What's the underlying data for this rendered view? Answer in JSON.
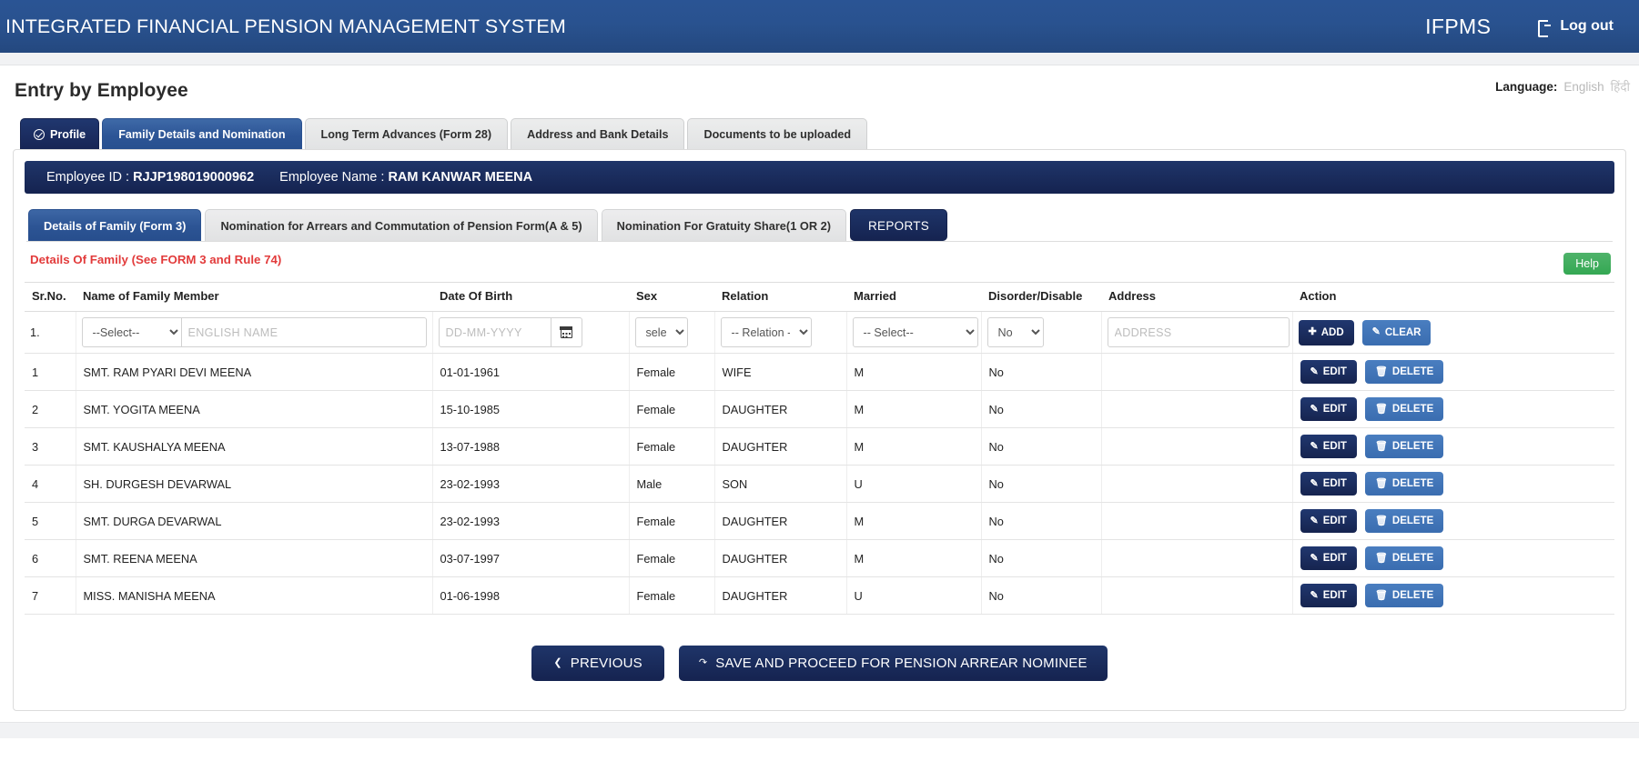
{
  "topbar": {
    "system_title": "INTEGRATED FINANCIAL PENSION MANAGEMENT SYSTEM",
    "brand": "IFPMS",
    "logout_label": "Log out",
    "logout_icon": "logout-icon"
  },
  "page": {
    "title": "Entry by Employee",
    "language_label": "Language:",
    "language_english": "English",
    "language_hindi": "हिंदी"
  },
  "main_tabs": [
    {
      "label": "Profile",
      "state": "completed",
      "icon": "check-circle-icon"
    },
    {
      "label": "Family Details and Nomination",
      "state": "active"
    },
    {
      "label": "Long Term Advances (Form 28)",
      "state": "normal"
    },
    {
      "label": "Address and Bank Details",
      "state": "normal"
    },
    {
      "label": "Documents to be uploaded",
      "state": "normal"
    }
  ],
  "employee": {
    "id_label": "Employee ID :",
    "id_value": "RJJP198019000962",
    "name_label": "Employee Name :",
    "name_value": "RAM KANWAR MEENA"
  },
  "sub_tabs": [
    {
      "label": "Details of Family (Form 3)",
      "state": "active"
    },
    {
      "label": "Nomination for Arrears and Commutation of Pension Form(A & 5)",
      "state": "normal"
    },
    {
      "label": "Nomination For Gratuity Share(1 OR 2)",
      "state": "normal"
    },
    {
      "label": "REPORTS",
      "state": "reports"
    }
  ],
  "section": {
    "title": "Details Of Family (See FORM 3 and Rule 74)",
    "title_color": "#e23b3b",
    "help_label": "Help",
    "help_color": "#34a853"
  },
  "table": {
    "headers": [
      "Sr.No.",
      "Name of Family Member",
      "Date Of Birth",
      "Sex",
      "Relation",
      "Married",
      "Disorder/Disable",
      "Address",
      "Action"
    ],
    "input_row": {
      "sr_no": "1.",
      "title_select_value": "--Select--",
      "name_placeholder": "ENGLISH NAME",
      "name_value": "",
      "dob_placeholder": "DD-MM-YYYY",
      "dob_value": "",
      "calendar_icon": "calendar-icon",
      "sex_select_value": "select",
      "relation_select_value": "-- Relation --",
      "married_select_value": "-- Select--",
      "disorder_select_value": "No",
      "address_placeholder": "ADDRESS",
      "address_value": "",
      "add_label": "ADD",
      "add_icon": "plus-icon",
      "clear_label": "CLEAR",
      "clear_icon": "eraser-icon"
    },
    "row_actions": {
      "edit_label": "EDIT",
      "edit_icon": "edit-icon",
      "delete_label": "DELETE",
      "delete_icon": "trash-icon"
    },
    "rows": [
      {
        "sr_no": "1",
        "name": "SMT. RAM PYARI DEVI MEENA",
        "dob": "01-01-1961",
        "sex": "Female",
        "relation": "WIFE",
        "married": "M",
        "disorder": "No",
        "address": ""
      },
      {
        "sr_no": "2",
        "name": "SMT. YOGITA MEENA",
        "dob": "15-10-1985",
        "sex": "Female",
        "relation": "DAUGHTER",
        "married": "M",
        "disorder": "No",
        "address": ""
      },
      {
        "sr_no": "3",
        "name": "SMT. KAUSHALYA MEENA",
        "dob": "13-07-1988",
        "sex": "Female",
        "relation": "DAUGHTER",
        "married": "M",
        "disorder": "No",
        "address": ""
      },
      {
        "sr_no": "4",
        "name": "SH. DURGESH DEVARWAL",
        "dob": "23-02-1993",
        "sex": "Male",
        "relation": "SON",
        "married": "U",
        "disorder": "No",
        "address": ""
      },
      {
        "sr_no": "5",
        "name": "SMT. DURGA DEVARWAL",
        "dob": "23-02-1993",
        "sex": "Female",
        "relation": "DAUGHTER",
        "married": "M",
        "disorder": "No",
        "address": ""
      },
      {
        "sr_no": "6",
        "name": "SMT. REENA MEENA",
        "dob": "03-07-1997",
        "sex": "Female",
        "relation": "DAUGHTER",
        "married": "M",
        "disorder": "No",
        "address": ""
      },
      {
        "sr_no": "7",
        "name": "MISS. MANISHA MEENA",
        "dob": "01-06-1998",
        "sex": "Female",
        "relation": "DAUGHTER",
        "married": "U",
        "disorder": "No",
        "address": ""
      }
    ]
  },
  "footer": {
    "previous_label": "PREVIOUS",
    "previous_icon": "chevron-left-icon",
    "save_label": "SAVE AND PROCEED FOR PENSION ARREAR NOMINEE",
    "save_icon": "share-icon"
  },
  "colors": {
    "header_blue": "#29528f",
    "dark_navy": "#152350",
    "tab_blue": "#2c5494",
    "button_light_blue": "#3a6db0",
    "red_heading": "#e23b3b",
    "help_green": "#34a853"
  }
}
